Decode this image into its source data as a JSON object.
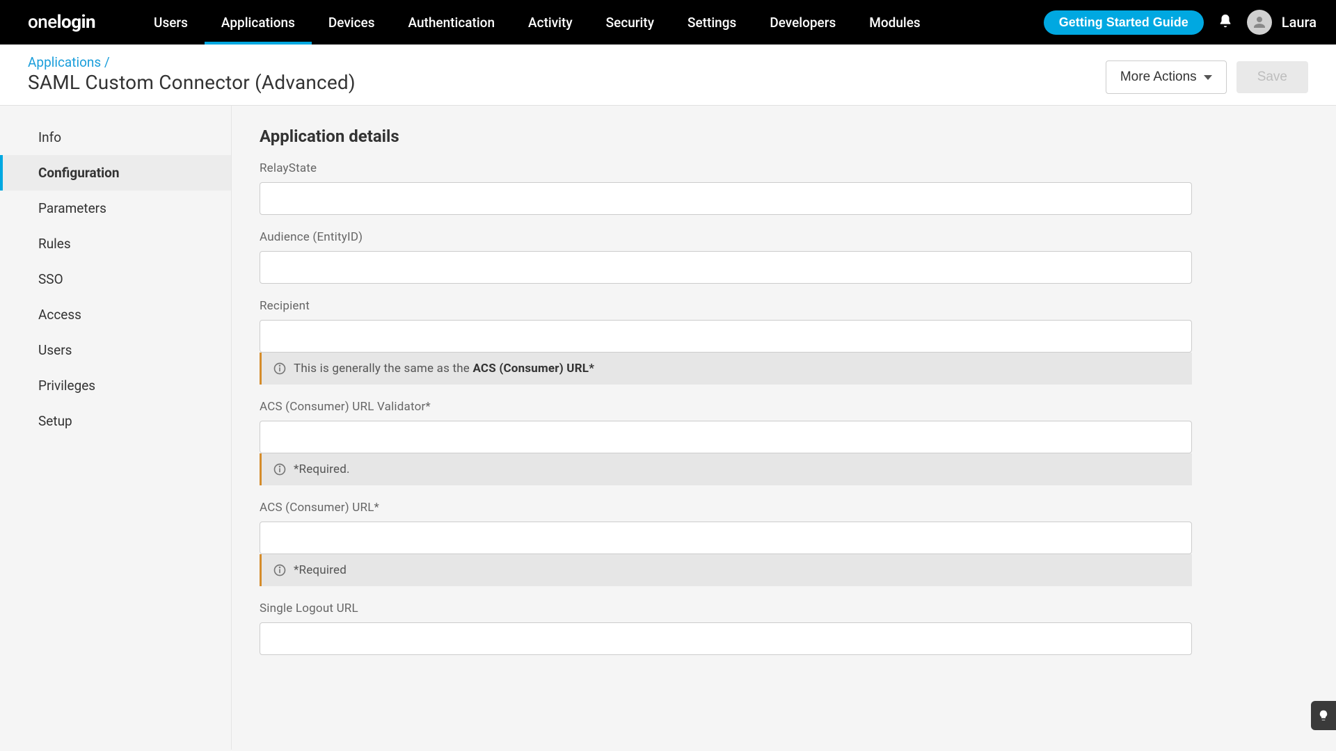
{
  "brand": {
    "part1": "one",
    "part2": "login"
  },
  "nav": {
    "items": [
      {
        "label": "Users"
      },
      {
        "label": "Applications"
      },
      {
        "label": "Devices"
      },
      {
        "label": "Authentication"
      },
      {
        "label": "Activity"
      },
      {
        "label": "Security"
      },
      {
        "label": "Settings"
      },
      {
        "label": "Developers"
      },
      {
        "label": "Modules"
      }
    ],
    "active_index": 1,
    "getting_started": "Getting Started Guide",
    "user": "Laura"
  },
  "subheader": {
    "breadcrumb": "Applications /",
    "title": "SAML Custom Connector (Advanced)",
    "more_actions": "More Actions",
    "save": "Save"
  },
  "sidebar": {
    "items": [
      {
        "label": "Info"
      },
      {
        "label": "Configuration"
      },
      {
        "label": "Parameters"
      },
      {
        "label": "Rules"
      },
      {
        "label": "SSO"
      },
      {
        "label": "Access"
      },
      {
        "label": "Users"
      },
      {
        "label": "Privileges"
      },
      {
        "label": "Setup"
      }
    ],
    "active_index": 1
  },
  "main": {
    "section_title": "Application details",
    "fields": {
      "relaystate": {
        "label": "RelayState",
        "value": ""
      },
      "audience": {
        "label": "Audience (EntityID)",
        "value": ""
      },
      "recipient": {
        "label": "Recipient",
        "value": ""
      },
      "recipient_hint_prefix": "This is generally the same as the ",
      "recipient_hint_bold": "ACS (Consumer) URL*",
      "acs_validator": {
        "label": "ACS (Consumer) URL Validator*",
        "value": ""
      },
      "acs_validator_hint": "*Required.",
      "acs_url": {
        "label": "ACS (Consumer) URL*",
        "value": ""
      },
      "acs_url_hint": "*Required",
      "slo": {
        "label": "Single Logout URL",
        "value": ""
      }
    }
  }
}
